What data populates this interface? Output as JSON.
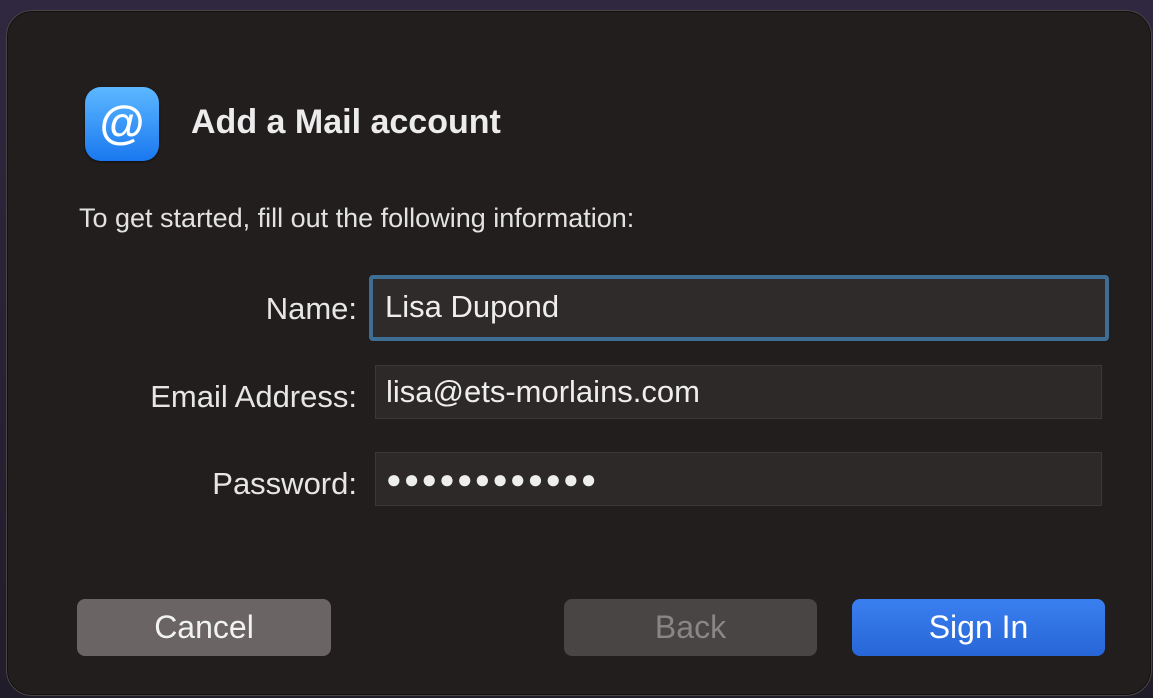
{
  "dialog": {
    "title": "Add a Mail account",
    "icon": "at-sign-icon",
    "subtitle": "To get started, fill out the following information:"
  },
  "form": {
    "name_label": "Name:",
    "name_value": "Lisa Dupond",
    "email_label": "Email Address:",
    "email_value": "lisa@ets-morlains.com",
    "password_label": "Password:",
    "password_value": "●●●●●●●●●●●●"
  },
  "buttons": {
    "cancel": "Cancel",
    "back": "Back",
    "sign_in": "Sign In"
  },
  "colors": {
    "accent": "#2c6fe0",
    "focus_ring": "#3f6e94",
    "dialog_bg": "#231e1e"
  }
}
